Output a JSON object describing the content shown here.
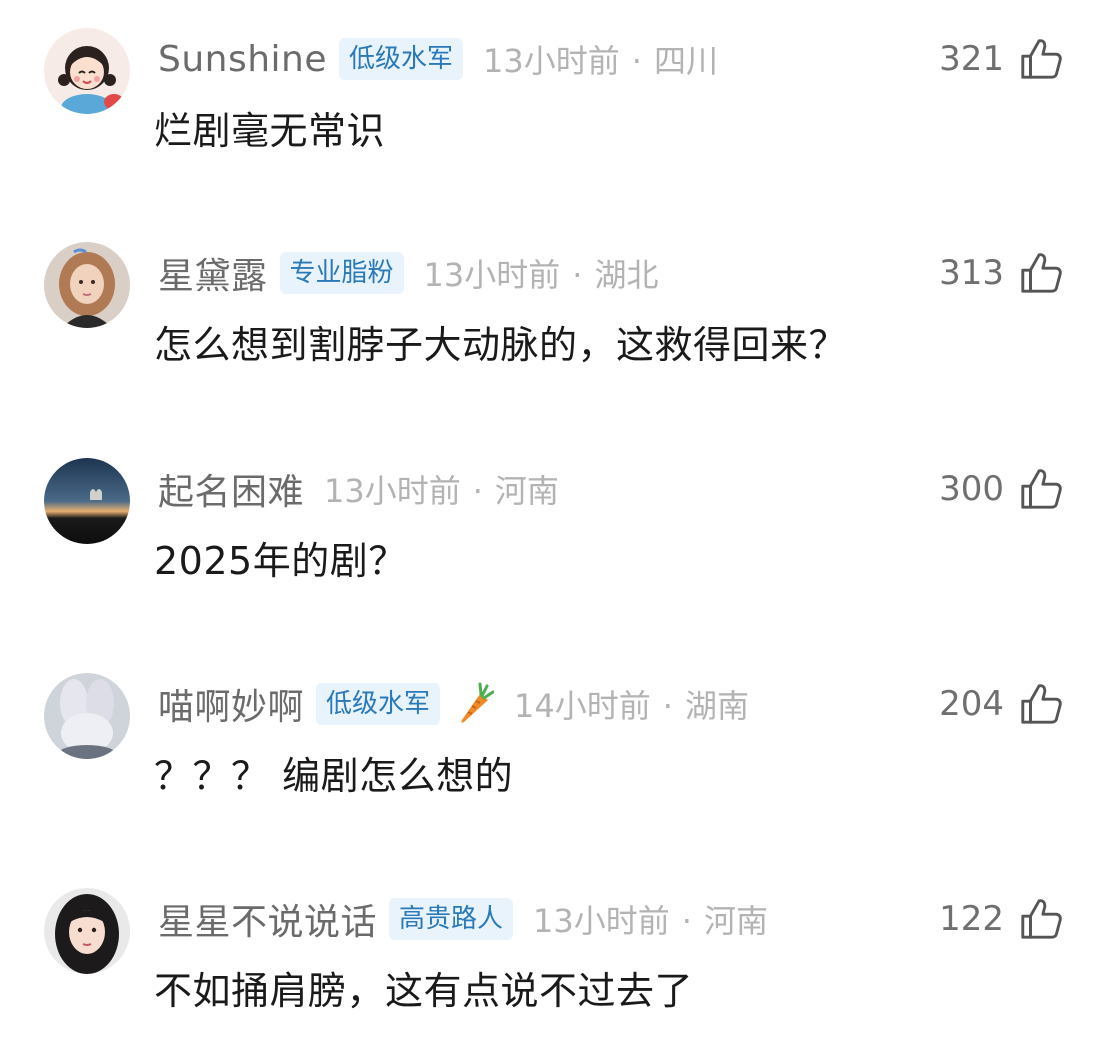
{
  "comments": [
    {
      "username": "Sunshine",
      "badge": "低级水军",
      "time": "13小时前",
      "location": "四川",
      "likes": "321",
      "content": "烂剧毫无常识",
      "avatar": "cartoon-girl-avatar"
    },
    {
      "username": "星黛露",
      "badge": "专业脂粉",
      "time": "13小时前",
      "location": "湖北",
      "likes": "313",
      "content": "怎么想到割脖子大动脉的，这救得回来？",
      "avatar": "woman-photo-avatar"
    },
    {
      "username": "起名困难",
      "time": "13小时前",
      "location": "河南",
      "likes": "300",
      "content": "2025年的剧？",
      "avatar": "sunset-sky-avatar"
    },
    {
      "username": "喵啊妙啊",
      "badge": "低级水军",
      "extra_icon": "carrot-icon",
      "time": "14小时前",
      "location": "湖南",
      "likes": "204",
      "content": "？？？ 编剧怎么想的",
      "avatar": "plush-bunny-avatar"
    },
    {
      "username": "星星不说说话",
      "badge": "高贵路人",
      "time": "13小时前",
      "location": "河南",
      "likes": "122",
      "content": "不如捅肩膀，这有点说不过去了",
      "avatar": "portrait-girl-avatar"
    }
  ],
  "separator": "·",
  "like_icon": "thumbs-up-icon",
  "colors": {
    "badge_text": "#2a79b8",
    "badge_bg": "#e8f3fb",
    "username": "#6b6b6b",
    "meta": "#b3b3b3",
    "content": "#1a1a1a"
  }
}
